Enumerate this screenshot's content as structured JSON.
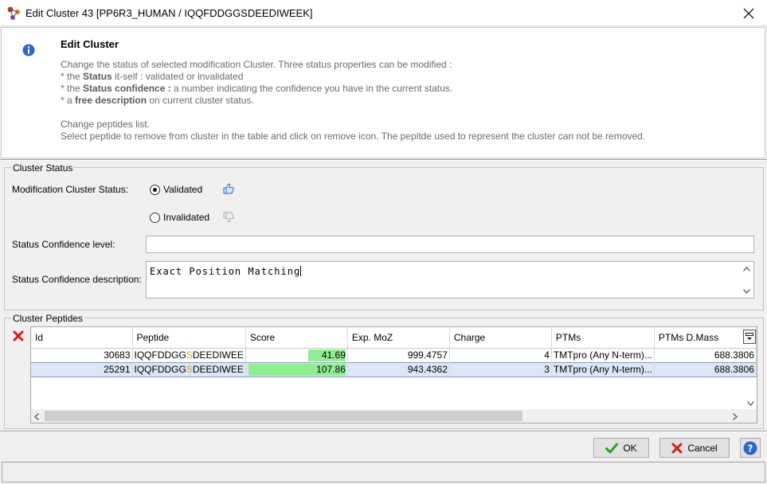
{
  "window": {
    "title": "Edit Cluster 43 [PP6R3_HUMAN / IQQFDDGGSDEEDIWEEK]"
  },
  "help": {
    "heading": "Edit Cluster",
    "intro": "Change the status of selected modification Cluster. Three status properties can be modified :",
    "item1_prefix": "* the ",
    "item1_bold": "Status",
    "item1_rest": " it-self : validated or invalidated",
    "item2_prefix": "* the ",
    "item2_bold": "Status confidence :",
    "item2_rest": " a number indicating the confidence you have in the current status.",
    "item3_prefix": "* a ",
    "item3_bold": "free description",
    "item3_rest": " on current cluster status.",
    "peptides_line1": "Change peptides list.",
    "peptides_line2": "Select peptide to remove from cluster in the table and click on remove icon. The pepitde used to represent the cluster can not be removed."
  },
  "status_section": {
    "legend": "Cluster Status",
    "status_label": "Modification Cluster Status:",
    "validated_label": "Validated",
    "invalidated_label": "Invalidated",
    "selected": "Validated",
    "confidence_level_label": "Status Confidence level:",
    "confidence_level_value": "",
    "confidence_desc_label": "Status Confidence description:",
    "confidence_desc_value": "Exact Position Matching"
  },
  "peptides_section": {
    "legend": "Cluster Peptides",
    "columns": [
      "Id",
      "Peptide",
      "Score",
      "Exp. MoZ",
      "Charge",
      "PTMs",
      "PTMs D.Mass"
    ],
    "rows": [
      {
        "id": "30683",
        "pep_a": "IQQFDDGG",
        "pep_s": "S",
        "pep_b": "DEEDIWEE",
        "score": "41.69",
        "score_value": 41.69,
        "exp_moz": "999.4757",
        "charge": "4",
        "ptms": "TMTpro (Any N-term)...",
        "ptms_dmass": "688.3806",
        "selected": false
      },
      {
        "id": "25291",
        "pep_a": "IQQFDDGG",
        "pep_s": "S",
        "pep_b": "DEEDIWEE",
        "score": "107.86",
        "score_value": 107.86,
        "exp_moz": "943.4362",
        "charge": "3",
        "ptms": "TMTpro (Any N-term)...",
        "ptms_dmass": "688.3806",
        "selected": true
      }
    ],
    "score_max": 107.86
  },
  "buttons": {
    "ok": "OK",
    "cancel": "Cancel"
  },
  "colors": {
    "score_bar": "#90ee90",
    "selection": "#dce6f4",
    "accent_icon": "#1f5fbf"
  }
}
